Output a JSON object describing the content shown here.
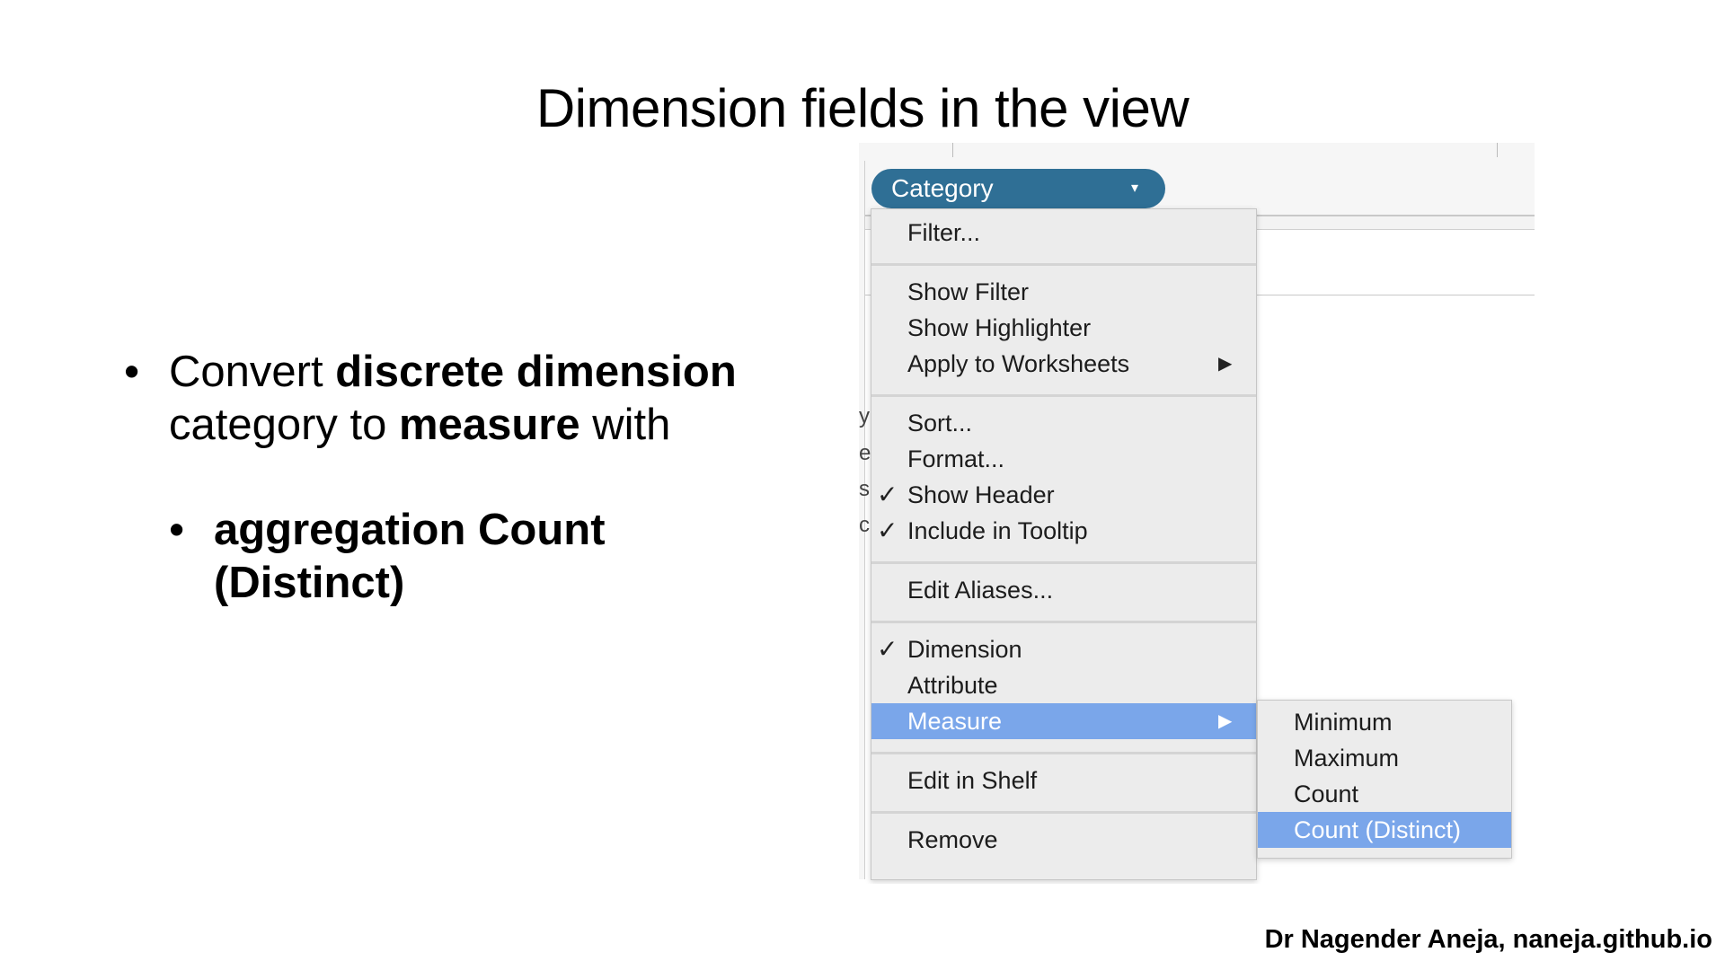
{
  "slide": {
    "title": "Dimension fields in the view",
    "bullet1": {
      "t1": "Convert ",
      "t2": "discrete dimension",
      "t3": "category to ",
      "t4": "measure",
      "t5": " with"
    },
    "bullet2": {
      "line1": "aggregation Count",
      "line2": "(Distinct)"
    },
    "bullet_char": "•",
    "footer": "Dr Nagender Aneja, naneja.github.io"
  },
  "screenshot": {
    "pill_label": "Category",
    "pill_caret": "▾",
    "check_char": "✓",
    "arrow_char": "▶",
    "menu": {
      "filter": "Filter...",
      "show_filter": "Show Filter",
      "show_highlighter": "Show Highlighter",
      "apply_worksheets": "Apply to Worksheets",
      "sort": "Sort...",
      "format": "Format...",
      "show_header": "Show Header",
      "include_tooltip": "Include in Tooltip",
      "edit_aliases": "Edit Aliases...",
      "dimension": "Dimension",
      "attribute": "Attribute",
      "measure": "Measure",
      "edit_in_shelf": "Edit in Shelf",
      "remove": "Remove"
    },
    "submenu": {
      "minimum": "Minimum",
      "maximum": "Maximum",
      "count": "Count",
      "count_distinct": "Count (Distinct)"
    },
    "cut_letters": [
      "y",
      "e",
      "s",
      "c"
    ],
    "colors": {
      "pill": "#2f6f95",
      "highlight": "#7aa6ea",
      "menu_bg": "#ececec"
    },
    "selected_item": "Measure",
    "selected_subitem": "Count (Distinct)"
  }
}
